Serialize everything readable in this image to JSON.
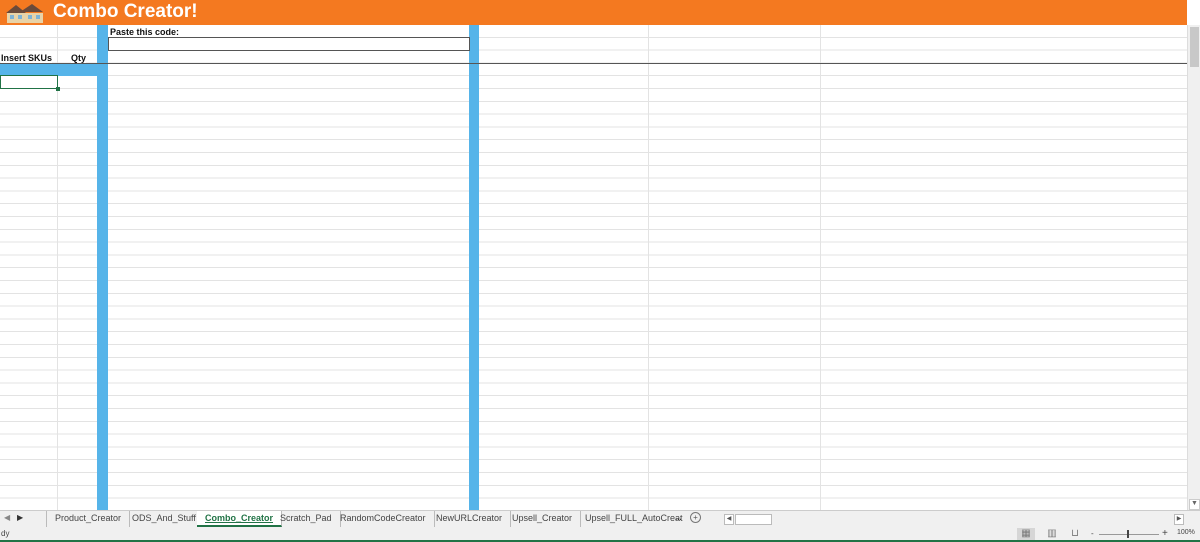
{
  "header": {
    "title": "Combo Creator!",
    "logo": "house-logo",
    "color": "#f47920"
  },
  "sheet": {
    "paste_label": "Paste this code:",
    "paste_value": "",
    "col_skus": "Insert SKUs",
    "col_qty": "Qty",
    "accent": "#56b4e9"
  },
  "tabs": [
    {
      "label": "Product_Creator"
    },
    {
      "label": "ODS_And_Stuff"
    },
    {
      "label": "Combo_Creator",
      "active": true
    },
    {
      "label": "Scratch_Pad"
    },
    {
      "label": "RandomCodeCreator"
    },
    {
      "label": "NewURLCreator"
    },
    {
      "label": "Upsell_Creator"
    },
    {
      "label": "Upsell_FULL_AutoCreat"
    }
  ],
  "more_tabs": "...",
  "add_sheet": "+",
  "status": {
    "text": "dy",
    "zoom": "100%",
    "zoom_minus": "-",
    "zoom_plus": "+"
  }
}
